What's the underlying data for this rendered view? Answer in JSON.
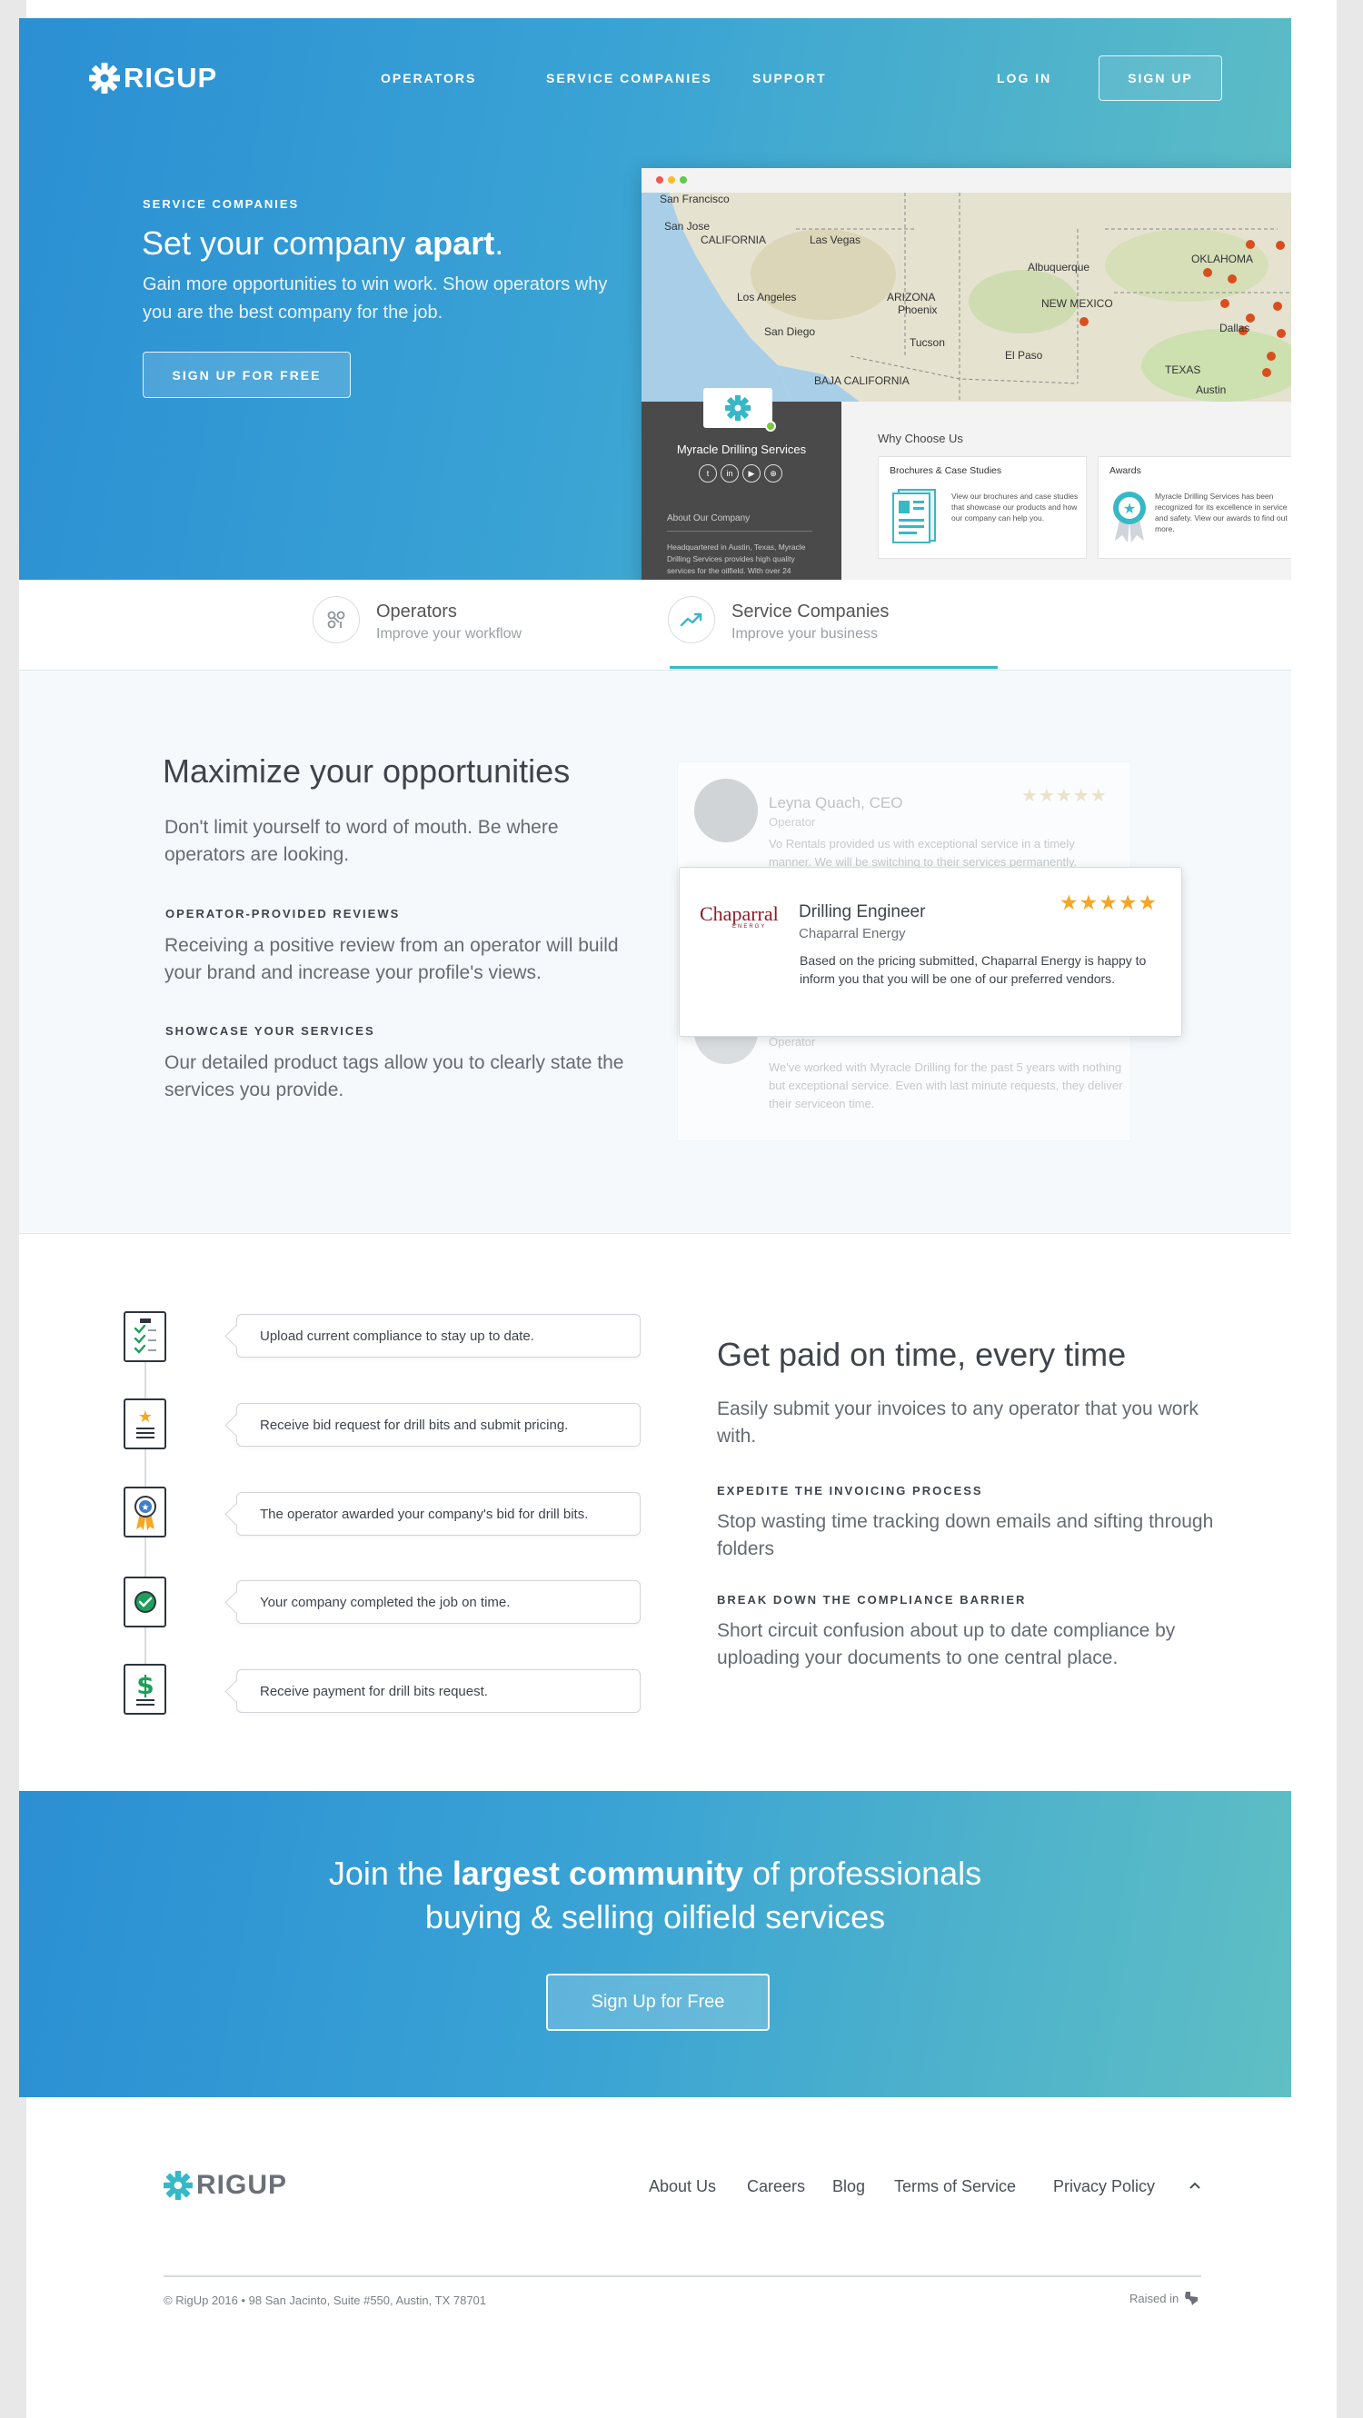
{
  "nav": {
    "brand": "RIGUP",
    "items": [
      "OPERATORS",
      "SERVICE COMPANIES",
      "SUPPORT"
    ],
    "login": "LOG IN",
    "signup": "SIGN UP"
  },
  "hero": {
    "eyebrow": "SERVICE COMPANIES",
    "title_pre": "Set your company ",
    "title_bold": "apart",
    "title_post": ".",
    "subtitle": "Gain more opportunities to win work. Show operators why you are the best company for the job.",
    "cta": "SIGN UP FOR FREE"
  },
  "mockup": {
    "map_labels": [
      "San Francisco",
      "San Jose",
      "CALIFORNIA",
      "Las Vegas",
      "Albuquerque",
      "OKLAHOMA",
      "ARIZONA",
      "Phoenix",
      "NEW MEXICO",
      "Los Angeles",
      "San Diego",
      "Tucson",
      "El Paso",
      "Dallas",
      "TEXAS",
      "Austin",
      "BAJA CALIFORNIA"
    ],
    "company": "Myracle Drilling Services",
    "social": [
      "t",
      "in",
      "▶",
      "⊕"
    ],
    "about_heading": "About Our Company",
    "about_text": "Headquartered in Austin, Texas, Myracle Drilling Services provides high quality services for the oilfield. With over 24",
    "why_heading": "Why Choose Us",
    "card1_title": "Brochures & Case Studies",
    "card1_text": "View our brochures and case studies that showcase our products and how our company can help you.",
    "card2_title": "Awards",
    "card2_text": "Myracle Drilling Services has been recognized for its excellence in service and safety. View our awards to find out more."
  },
  "tabs": [
    {
      "title": "Operators",
      "subtitle": "Improve your workflow"
    },
    {
      "title": "Service Companies",
      "subtitle": "Improve your business"
    }
  ],
  "opportunities": {
    "title": "Maximize your opportunities",
    "intro": "Don't limit yourself to word of mouth. Be where operators are looking.",
    "label1": "OPERATOR-PROVIDED REVIEWS",
    "text1": "Receiving a positive review from an operator will build your brand and increase your profile's views.",
    "label2": "SHOWCASE YOUR SERVICES",
    "text2": "Our detailed product tags allow you to clearly state the services you provide."
  },
  "reviews": {
    "ghost1_name": "Leyna Quach, CEO",
    "ghost1_role": "Operator",
    "ghost1_text": "Vo Rentals provided us with exceptional service in a timely manner. We will be switching to their services permanently.",
    "ghost2_role": "Operator",
    "ghost2_text": "We've worked with Myracle Drilling for the past 5 years with nothing but exceptional service. Even with last minute requests, they deliver their serviceon time.",
    "main_logo": "Chaparral",
    "main_logo_sub": "ENERGY",
    "main_title": "Drilling Engineer",
    "main_company": "Chaparral Energy",
    "main_text": "Based on the pricing submitted, Chaparral Energy is happy to inform you that you will be one of our preferred vendors.",
    "main_rating": 5
  },
  "steps": [
    "Upload current compliance to stay up to date.",
    "Receive bid request for drill bits and submit pricing.",
    "The operator awarded your company's bid for drill bits.",
    "Your company completed the job on time.",
    "Receive payment for drill bits request."
  ],
  "paid": {
    "title": "Get paid on time, every time",
    "intro": "Easily submit your invoices to any operator that you work with.",
    "label1": "EXPEDITE THE INVOICING PROCESS",
    "text1": "Stop wasting time tracking down emails and sifting through folders",
    "label2": "BREAK DOWN THE COMPLIANCE BARRIER",
    "text2": "Short circuit confusion about up to date compliance by uploading your documents to one central place."
  },
  "cta": {
    "line1_pre": "Join the ",
    "line1_bold": "largest community",
    "line1_post": " of professionals",
    "line2": "buying & selling oilfield services",
    "button": "Sign Up for Free"
  },
  "footer": {
    "brand": "RIGUP",
    "links": [
      "About Us",
      "Careers",
      "Blog",
      "Terms of Service",
      "Privacy Policy"
    ],
    "copyright": "© RigUp 2016 • 98 San Jacinto, Suite #550, Austin, TX 78701",
    "raised": "Raised in"
  },
  "colors": {
    "accent": "#37b8c6",
    "brand_blue": "#2b8fd3",
    "star": "#f5a623",
    "pin": "#d94e1f"
  }
}
